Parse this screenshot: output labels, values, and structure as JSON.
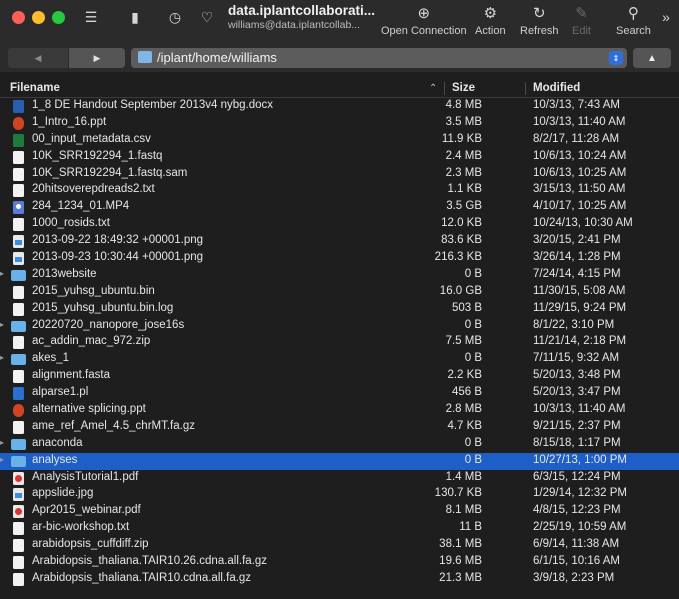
{
  "toolbar": {
    "title": "data.iplantcollaborati...",
    "subtitle": "williams@data.iplantcollab...",
    "open_connection": "Open Connection",
    "action": "Action",
    "refresh": "Refresh",
    "edit": "Edit",
    "search": "Search"
  },
  "navigation": {
    "path": "/iplant/home/williams"
  },
  "columns": {
    "filename": "Filename",
    "size": "Size",
    "modified": "Modified"
  },
  "files": [
    {
      "name": "1_8 DE Handout September 2013v4 nybg.docx",
      "size": "4.8 MB",
      "modified": "10/3/13, 7:43 AM",
      "icon": "doc"
    },
    {
      "name": "1_Intro_16.ppt",
      "size": "3.5 MB",
      "modified": "10/3/13, 11:40 AM",
      "icon": "ppt"
    },
    {
      "name": "00_input_metadata.csv",
      "size": "11.9 KB",
      "modified": "8/2/17, 11:28 AM",
      "icon": "csv"
    },
    {
      "name": "10K_SRR192294_1.fastq",
      "size": "2.4 MB",
      "modified": "10/6/13, 10:24 AM",
      "icon": "file"
    },
    {
      "name": "10K_SRR192294_1.fastq.sam",
      "size": "2.3 MB",
      "modified": "10/6/13, 10:25 AM",
      "icon": "file"
    },
    {
      "name": "20hitsoverepdreads2.txt",
      "size": "1.1 KB",
      "modified": "3/15/13, 11:50 AM",
      "icon": "file"
    },
    {
      "name": "284_1234_01.MP4",
      "size": "3.5 GB",
      "modified": "4/10/17, 10:25 AM",
      "icon": "media"
    },
    {
      "name": "1000_rosids.txt",
      "size": "12.0 KB",
      "modified": "10/24/13, 10:30 AM",
      "icon": "file"
    },
    {
      "name": "2013-09-22 18:49:32 +00001.png",
      "size": "83.6 KB",
      "modified": "3/20/15, 2:41 PM",
      "icon": "image"
    },
    {
      "name": "2013-09-23 10:30:44 +00001.png",
      "size": "216.3 KB",
      "modified": "3/26/14, 1:28 PM",
      "icon": "image"
    },
    {
      "name": "2013website",
      "size": "0 B",
      "modified": "7/24/14, 4:15 PM",
      "icon": "folder"
    },
    {
      "name": "2015_yuhsg_ubuntu.bin",
      "size": "16.0 GB",
      "modified": "11/30/15, 5:08 AM",
      "icon": "binary"
    },
    {
      "name": "2015_yuhsg_ubuntu.bin.log",
      "size": "503 B",
      "modified": "11/29/15, 9:24 PM",
      "icon": "file"
    },
    {
      "name": "20220720_nanopore_jose16s",
      "size": "0 B",
      "modified": "8/1/22, 3:10 PM",
      "icon": "folder"
    },
    {
      "name": "ac_addin_mac_972.zip",
      "size": "7.5 MB",
      "modified": "11/21/14, 2:18 PM",
      "icon": "binary"
    },
    {
      "name": "akes_1",
      "size": "0 B",
      "modified": "7/11/15, 9:32 AM",
      "icon": "folder"
    },
    {
      "name": "alignment.fasta",
      "size": "2.2 KB",
      "modified": "5/20/13, 3:48 PM",
      "icon": "file"
    },
    {
      "name": "alparse1.pl",
      "size": "456 B",
      "modified": "5/20/13, 3:47 PM",
      "icon": "perl"
    },
    {
      "name": "alternative splicing.ppt",
      "size": "2.8 MB",
      "modified": "10/3/13, 11:40 AM",
      "icon": "ppt"
    },
    {
      "name": "ame_ref_Amel_4.5_chrMT.fa.gz",
      "size": "4.7 KB",
      "modified": "9/21/15, 2:37 PM",
      "icon": "binary"
    },
    {
      "name": "anaconda",
      "size": "0 B",
      "modified": "8/15/18, 1:17 PM",
      "icon": "folder"
    },
    {
      "name": "analyses",
      "size": "0 B",
      "modified": "10/27/13, 1:00 PM",
      "icon": "folder",
      "selected": true
    },
    {
      "name": "AnalysisTutorial1.pdf",
      "size": "1.4 MB",
      "modified": "6/3/15, 12:24 PM",
      "icon": "pdf"
    },
    {
      "name": "appslide.jpg",
      "size": "130.7 KB",
      "modified": "1/29/14, 12:32 PM",
      "icon": "image"
    },
    {
      "name": "Apr2015_webinar.pdf",
      "size": "8.1 MB",
      "modified": "4/8/15, 12:23 PM",
      "icon": "pdf"
    },
    {
      "name": "ar-bic-workshop.txt",
      "size": "11 B",
      "modified": "2/25/19, 10:59 AM",
      "icon": "file"
    },
    {
      "name": "arabidopsis_cuffdiff.zip",
      "size": "38.1 MB",
      "modified": "6/9/14, 11:38 AM",
      "icon": "binary"
    },
    {
      "name": "Arabidopsis_thaliana.TAIR10.26.cdna.all.fa.gz",
      "size": "19.6 MB",
      "modified": "6/1/15, 10:16 AM",
      "icon": "binary"
    },
    {
      "name": "Arabidopsis_thaliana.TAIR10.cdna.all.fa.gz",
      "size": "21.3 MB",
      "modified": "3/9/18, 2:23 PM",
      "icon": "binary"
    }
  ]
}
